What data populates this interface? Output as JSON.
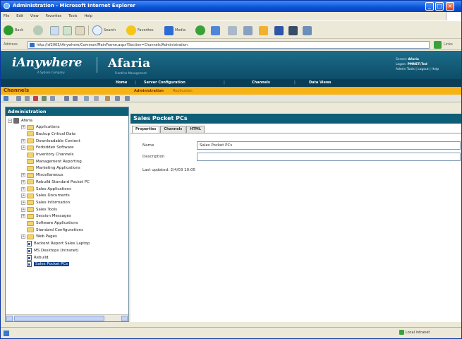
{
  "window": {
    "title": "Administration - Microsoft Internet Explorer",
    "menu": [
      "File",
      "Edit",
      "View",
      "Favorites",
      "Tools",
      "Help"
    ],
    "toolbar": {
      "back": "Back",
      "search": "Search",
      "favorites": "Favorites",
      "media": "Media"
    },
    "address_label": "Address",
    "address_url": "http://sf2003/iAnywhere/Common/MainFrame.aspx?Section=Channels/Administration",
    "links_label": "Links"
  },
  "banner": {
    "brand_primary": "iAnywhere",
    "brand_primary_sub": "A Sybase Company",
    "brand_secondary": "Afaria",
    "brand_secondary_sub": "Frontline Management",
    "user_label": "Server:",
    "user_value": "Afaria",
    "role_label": "Logon:",
    "role_value": "PMNET\\Ted",
    "user_links": "Admin Tools | Logout | Help"
  },
  "nav": {
    "items": [
      "Home",
      "Server Configuration",
      "Channels",
      "Data Views"
    ]
  },
  "channels_bar": {
    "section": "Channels",
    "tab_admin": "Administration",
    "tab_replication": "Replication"
  },
  "tree": {
    "header": "Administration",
    "root": "Afaria",
    "items": [
      {
        "label": "Applications",
        "type": "folder",
        "expandable": true
      },
      {
        "label": "Backup Critical Data",
        "type": "folder",
        "expandable": false
      },
      {
        "label": "Downloadable Content",
        "type": "folder",
        "expandable": true
      },
      {
        "label": "Forbidden Software",
        "type": "folder",
        "expandable": true
      },
      {
        "label": "Inventory Channels",
        "type": "folder",
        "expandable": false
      },
      {
        "label": "Management Reporting",
        "type": "folder",
        "expandable": false
      },
      {
        "label": "Marketing Applications",
        "type": "folder",
        "expandable": false
      },
      {
        "label": "Miscellaneous",
        "type": "folder",
        "expandable": true
      },
      {
        "label": "Rebuild Standard Pocket PC",
        "type": "folder",
        "expandable": true
      },
      {
        "label": "Sales Applications",
        "type": "folder",
        "expandable": true
      },
      {
        "label": "Sales Documents",
        "type": "folder",
        "expandable": true
      },
      {
        "label": "Sales Information",
        "type": "folder",
        "expandable": true
      },
      {
        "label": "Sales Tools",
        "type": "folder",
        "expandable": true
      },
      {
        "label": "Session Messages",
        "type": "folder",
        "expandable": true
      },
      {
        "label": "Software Applications",
        "type": "folder",
        "expandable": false
      },
      {
        "label": "Standard Configurations",
        "type": "folder",
        "expandable": false
      },
      {
        "label": "Web Pages",
        "type": "folder",
        "expandable": true
      },
      {
        "label": "Backent Report Sales Laptop",
        "type": "page",
        "expandable": false
      },
      {
        "label": "MS Desktops (Intranet)",
        "type": "page",
        "expandable": false
      },
      {
        "label": "Rebuild",
        "type": "page",
        "expandable": false
      },
      {
        "label": "Sales Pocket PCs",
        "type": "page",
        "expandable": false,
        "selected": true
      }
    ]
  },
  "detail": {
    "title": "Sales Pocket PCs",
    "tabs": [
      "Properties",
      "Channels",
      "HTML"
    ],
    "name_label": "Name",
    "name_value": "Sales Pocket PCs",
    "description_label": "Description",
    "description_value": "",
    "last_updated": "Last updated: 2/4/03 10:05"
  },
  "status": {
    "zone": "Local intranet"
  }
}
